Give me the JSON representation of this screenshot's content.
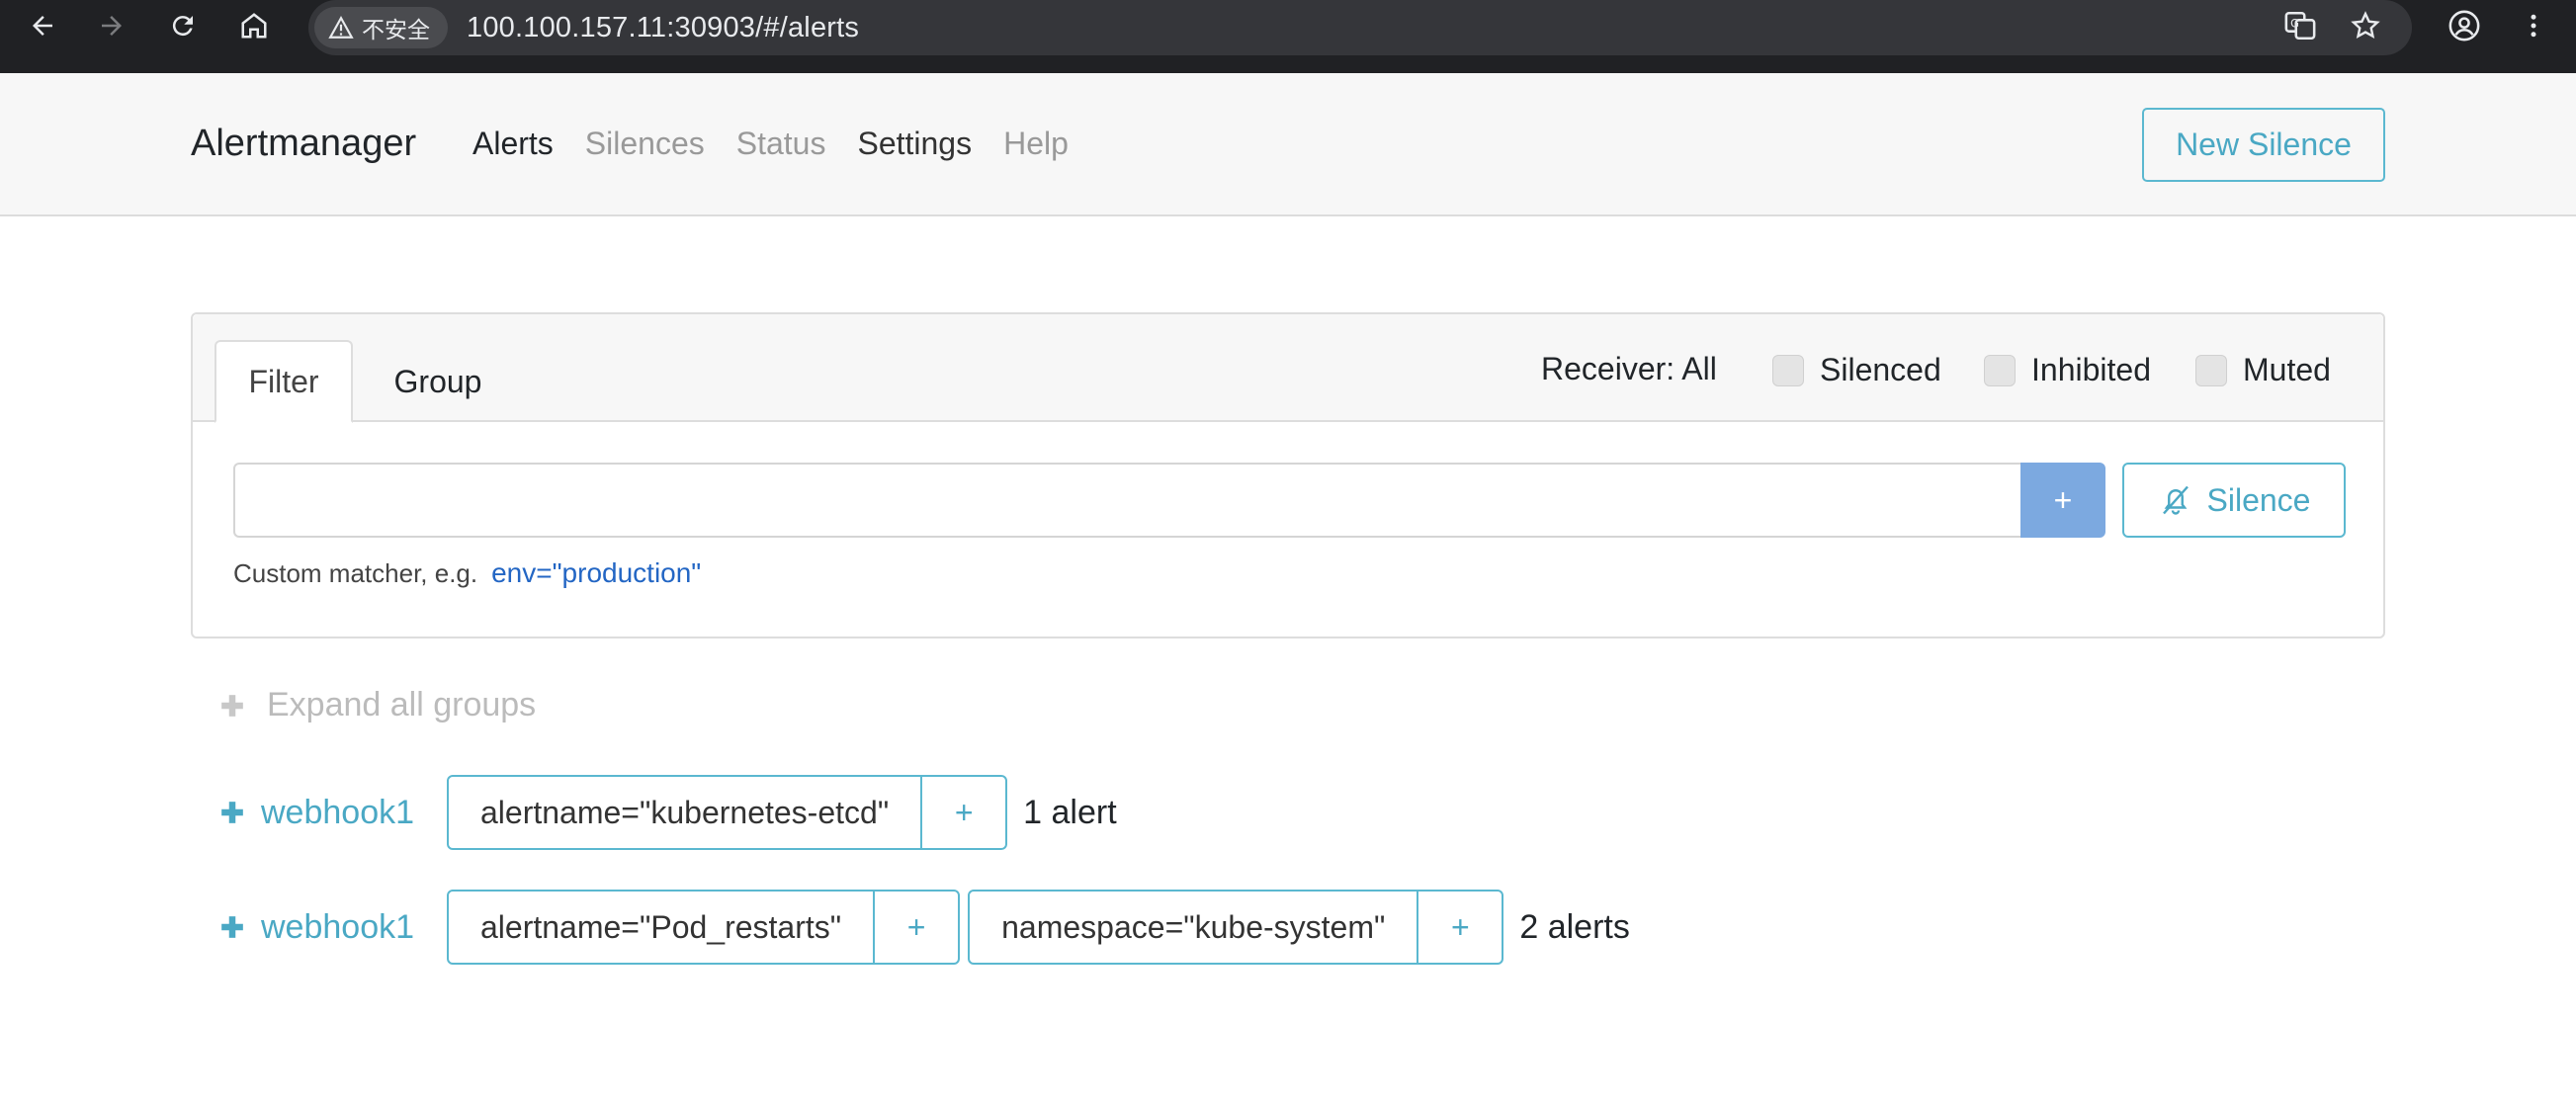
{
  "browser": {
    "security_label": "不安全",
    "url": "100.100.157.11:30903/#/alerts"
  },
  "navbar": {
    "brand": "Alertmanager",
    "links": [
      {
        "label": "Alerts"
      },
      {
        "label": "Silences"
      },
      {
        "label": "Status"
      },
      {
        "label": "Settings"
      },
      {
        "label": "Help"
      }
    ],
    "new_silence_label": "New Silence"
  },
  "filter": {
    "tabs": [
      {
        "label": "Filter"
      },
      {
        "label": "Group"
      }
    ],
    "receiver_label": "Receiver: All",
    "checkboxes": [
      {
        "label": "Silenced",
        "checked": false
      },
      {
        "label": "Inhibited",
        "checked": false
      },
      {
        "label": "Muted",
        "checked": false
      }
    ],
    "input_value": "",
    "add_label": "+",
    "silence_label": "Silence",
    "hint_text": "Custom matcher, e.g.",
    "hint_example": "env=\"production\""
  },
  "expand_all_label": "Expand all groups",
  "groups": [
    {
      "receiver": "webhook1",
      "matchers": [
        {
          "label": "alertname=\"kubernetes-etcd\"",
          "plus": "+"
        }
      ],
      "count": "1 alert"
    },
    {
      "receiver": "webhook1",
      "matchers": [
        {
          "label": "alertname=\"Pod_restarts\"",
          "plus": "+"
        },
        {
          "label": "namespace=\"kube-system\"",
          "plus": "+"
        }
      ],
      "count": "2 alerts"
    }
  ],
  "colors": {
    "accent": "#4aa8c4",
    "primary_button": "#7ca9e0",
    "chrome_bg": "#202124",
    "navbar_bg": "#f7f7f7"
  }
}
